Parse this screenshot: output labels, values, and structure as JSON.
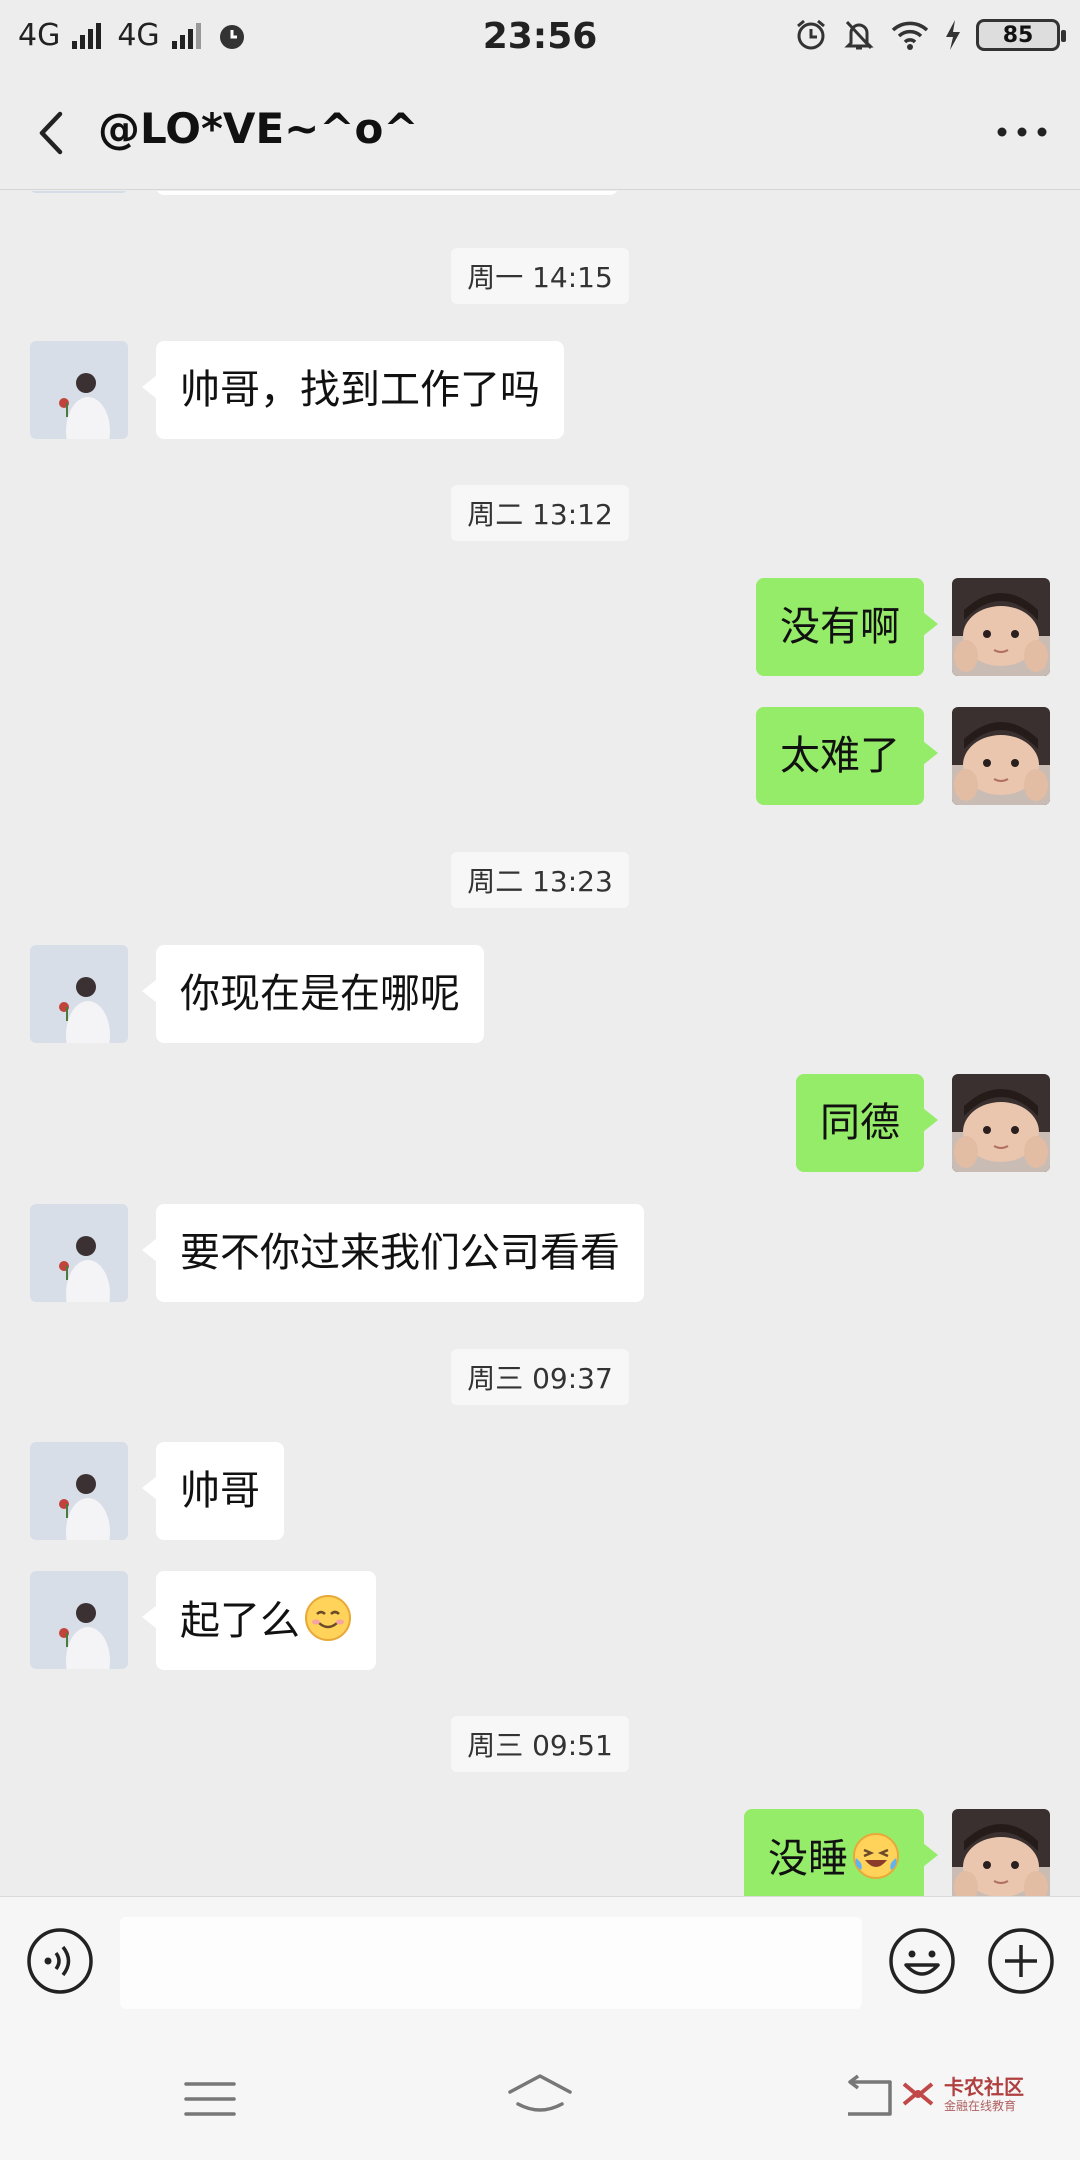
{
  "status_bar": {
    "network_1": "4G",
    "network_2": "4G",
    "time": "23:56",
    "battery": "85"
  },
  "nav": {
    "title": "@LO*VE~^o^",
    "back_icon": "back-arrow-icon",
    "more_icon": "more-dots-icon"
  },
  "chat": {
    "timestamps": [
      "周一 14:15",
      "周二 13:12",
      "周二 13:23",
      "周三 09:37",
      "周三 09:51"
    ],
    "messages": [
      {
        "from": "contact",
        "text": "帅哥，找到工作了吗"
      },
      {
        "from": "me",
        "text": "没有啊"
      },
      {
        "from": "me",
        "text": "太难了"
      },
      {
        "from": "contact",
        "text": "你现在是在哪呢"
      },
      {
        "from": "me",
        "text": "同德"
      },
      {
        "from": "contact",
        "text": "要不你过来我们公司看看"
      },
      {
        "from": "contact",
        "text": "帅哥"
      },
      {
        "from": "contact",
        "text": "起了么",
        "emoji": "smiling-blush-emoji"
      },
      {
        "from": "me",
        "text": "没睡",
        "emoji": "laughing-tears-emoji"
      }
    ]
  },
  "input_bar": {
    "voice_icon": "voice-icon",
    "text_value": "",
    "emoji_icon": "emoji-icon",
    "plus_icon": "plus-icon"
  },
  "system_nav": {
    "menu_icon": "menu-icon",
    "home_icon": "home-icon",
    "back_icon": "back-icon",
    "watermark_name": "卡农社区",
    "watermark_sub": "金融在线教育"
  },
  "colors": {
    "background": "#ededed",
    "my_bubble": "#95ec69",
    "their_bubble": "#ffffff"
  }
}
